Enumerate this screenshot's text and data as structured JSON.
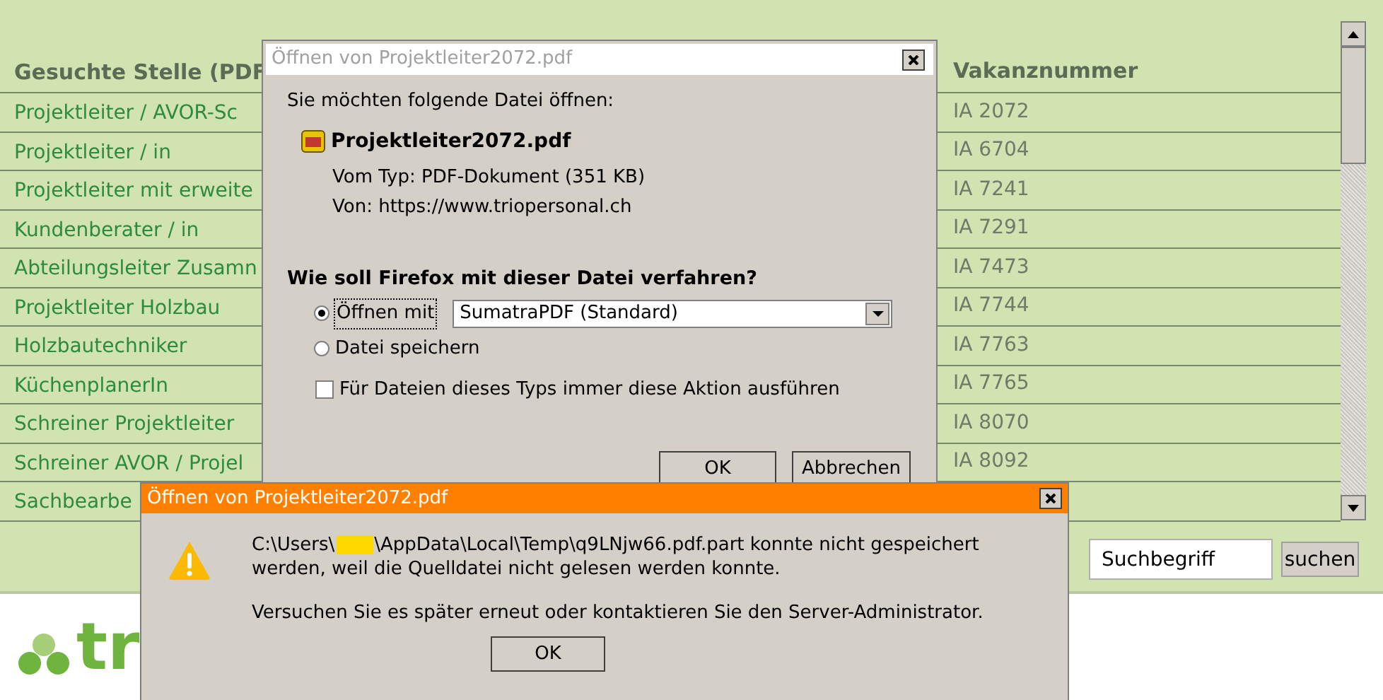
{
  "table": {
    "columns": [
      "Gesuchte Stelle (PDF",
      "Vakanznummer"
    ],
    "rows": [
      {
        "title": "Projektleiter / AVOR-Sc",
        "number": "IA 2072"
      },
      {
        "title": "Projektleiter / in",
        "number": "IA 6704"
      },
      {
        "title": "Projektleiter mit erweite",
        "number": "IA 7241"
      },
      {
        "title": "Kundenberater / in",
        "number": "IA 7291"
      },
      {
        "title": "Abteilungsleiter Zusamn",
        "number": "IA 7473"
      },
      {
        "title": "Projektleiter Holzbau",
        "number": "IA 7744"
      },
      {
        "title": "Holzbautechniker",
        "number": "IA 7763"
      },
      {
        "title": "KüchenplanerIn",
        "number": "IA 7765"
      },
      {
        "title": "Schreiner Projektleiter",
        "number": "IA 8070"
      },
      {
        "title": "Schreiner AVOR / Projel",
        "number": "IA 8092"
      },
      {
        "title": "Sachbearbe"
      }
    ]
  },
  "search": {
    "value": "Suchbegriff",
    "button": "suchen"
  },
  "logo": {
    "text": "tr"
  },
  "open_dialog": {
    "title": "Öffnen von Projektleiter2072.pdf",
    "intro": "Sie möchten folgende Datei öffnen:",
    "file_name": "Projektleiter2072.pdf",
    "type_line": "Vom Typ: PDF-Dokument (351 KB)",
    "source_line": "Von: https://www.triopersonal.ch",
    "question": "Wie soll Firefox mit dieser Datei verfahren?",
    "options": [
      {
        "label": "Öffnen mit",
        "selected": true
      },
      {
        "label": "Datei speichern",
        "selected": false
      }
    ],
    "app_select": {
      "value": "SumatraPDF (Standard)"
    },
    "remember": {
      "label": "Für Dateien dieses Typs immer diese Aktion ausführen",
      "checked": false
    },
    "buttons": [
      "OK",
      "Abbrechen"
    ]
  },
  "error_dialog": {
    "title": "Öffnen von Projektleiter2072.pdf",
    "message_start": "C:\\Users\\",
    "message_end": "\\AppData\\Local\\Temp\\q9LNjw66.pdf.part konnte nicht gespeichert werden, weil die Quelldatei nicht gelesen werden konnte.",
    "hint": "Versuchen Sie es später erneut oder kontaktieren Sie den Server-Administrator.",
    "button": "OK"
  }
}
